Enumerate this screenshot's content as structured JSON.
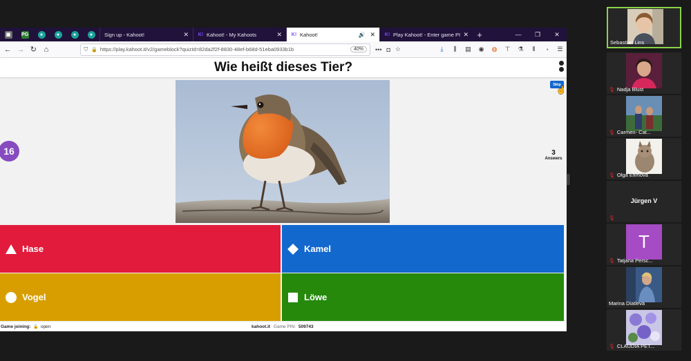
{
  "browser": {
    "pinned_tabs": [
      {
        "icon": "screen-icon",
        "color": "#6e6e6e",
        "glyph": "▣"
      },
      {
        "icon": "pg-icon",
        "color": "#2e7d32",
        "glyph": "PG"
      },
      {
        "icon": "teal-app-icon",
        "color": "#1aa39a",
        "glyph": "●"
      },
      {
        "icon": "teal-app-icon",
        "color": "#1aa39a",
        "glyph": "●"
      },
      {
        "icon": "teal-app-icon",
        "color": "#1aa39a",
        "glyph": "●"
      },
      {
        "icon": "teal-app-icon",
        "color": "#1aa39a",
        "glyph": "●"
      }
    ],
    "tabs": [
      {
        "label": "Sign up - Kahoot!",
        "active": false,
        "favicon": ""
      },
      {
        "label": "Kahoot! - My Kahoots",
        "active": false,
        "favicon": "K!"
      },
      {
        "label": "Kahoot!",
        "active": true,
        "favicon": "K!"
      },
      {
        "label": "Play Kahoot! - Enter game PIN",
        "active": false,
        "favicon": "K!"
      }
    ],
    "url": "https://play.kahoot.it/v2/gameblock?quizId=82da2f2f-8830-48ef-b68d-51eba0933b1b",
    "zoom": "40%"
  },
  "game": {
    "question": "Wie heißt dieses Tier?",
    "timer": "16",
    "answers_count": "3",
    "answers_label": "Answers",
    "skip_label": "Skip",
    "options": [
      {
        "label": "Hase",
        "color": "#e21b3c",
        "shape": "triangle"
      },
      {
        "label": "Kamel",
        "color": "#1368ce",
        "shape": "diamond"
      },
      {
        "label": "Vogel",
        "color": "#d89e00",
        "shape": "circle"
      },
      {
        "label": "Löwe",
        "color": "#26890c",
        "shape": "square"
      }
    ],
    "footer": {
      "game_joining": "Game joining:",
      "status": "open",
      "brand": "kahoot.it",
      "pin_label": "Game PIN:",
      "pin": "509743"
    }
  },
  "participants": [
    {
      "name": "Sebastian Lins",
      "muted": false,
      "speaking": true
    },
    {
      "name": "Nadja Blust",
      "muted": true
    },
    {
      "name": "Carmen- Cat...",
      "muted": true
    },
    {
      "name": "Olga Efimova",
      "muted": true
    },
    {
      "name": "Jürgen V",
      "muted": true,
      "no_video": true
    },
    {
      "name": "Tatjana Persc...",
      "muted": true,
      "initial": "T"
    },
    {
      "name": "Marina Diatleva",
      "muted": false
    },
    {
      "name": "CLAUDIA PET...",
      "muted": true
    }
  ]
}
